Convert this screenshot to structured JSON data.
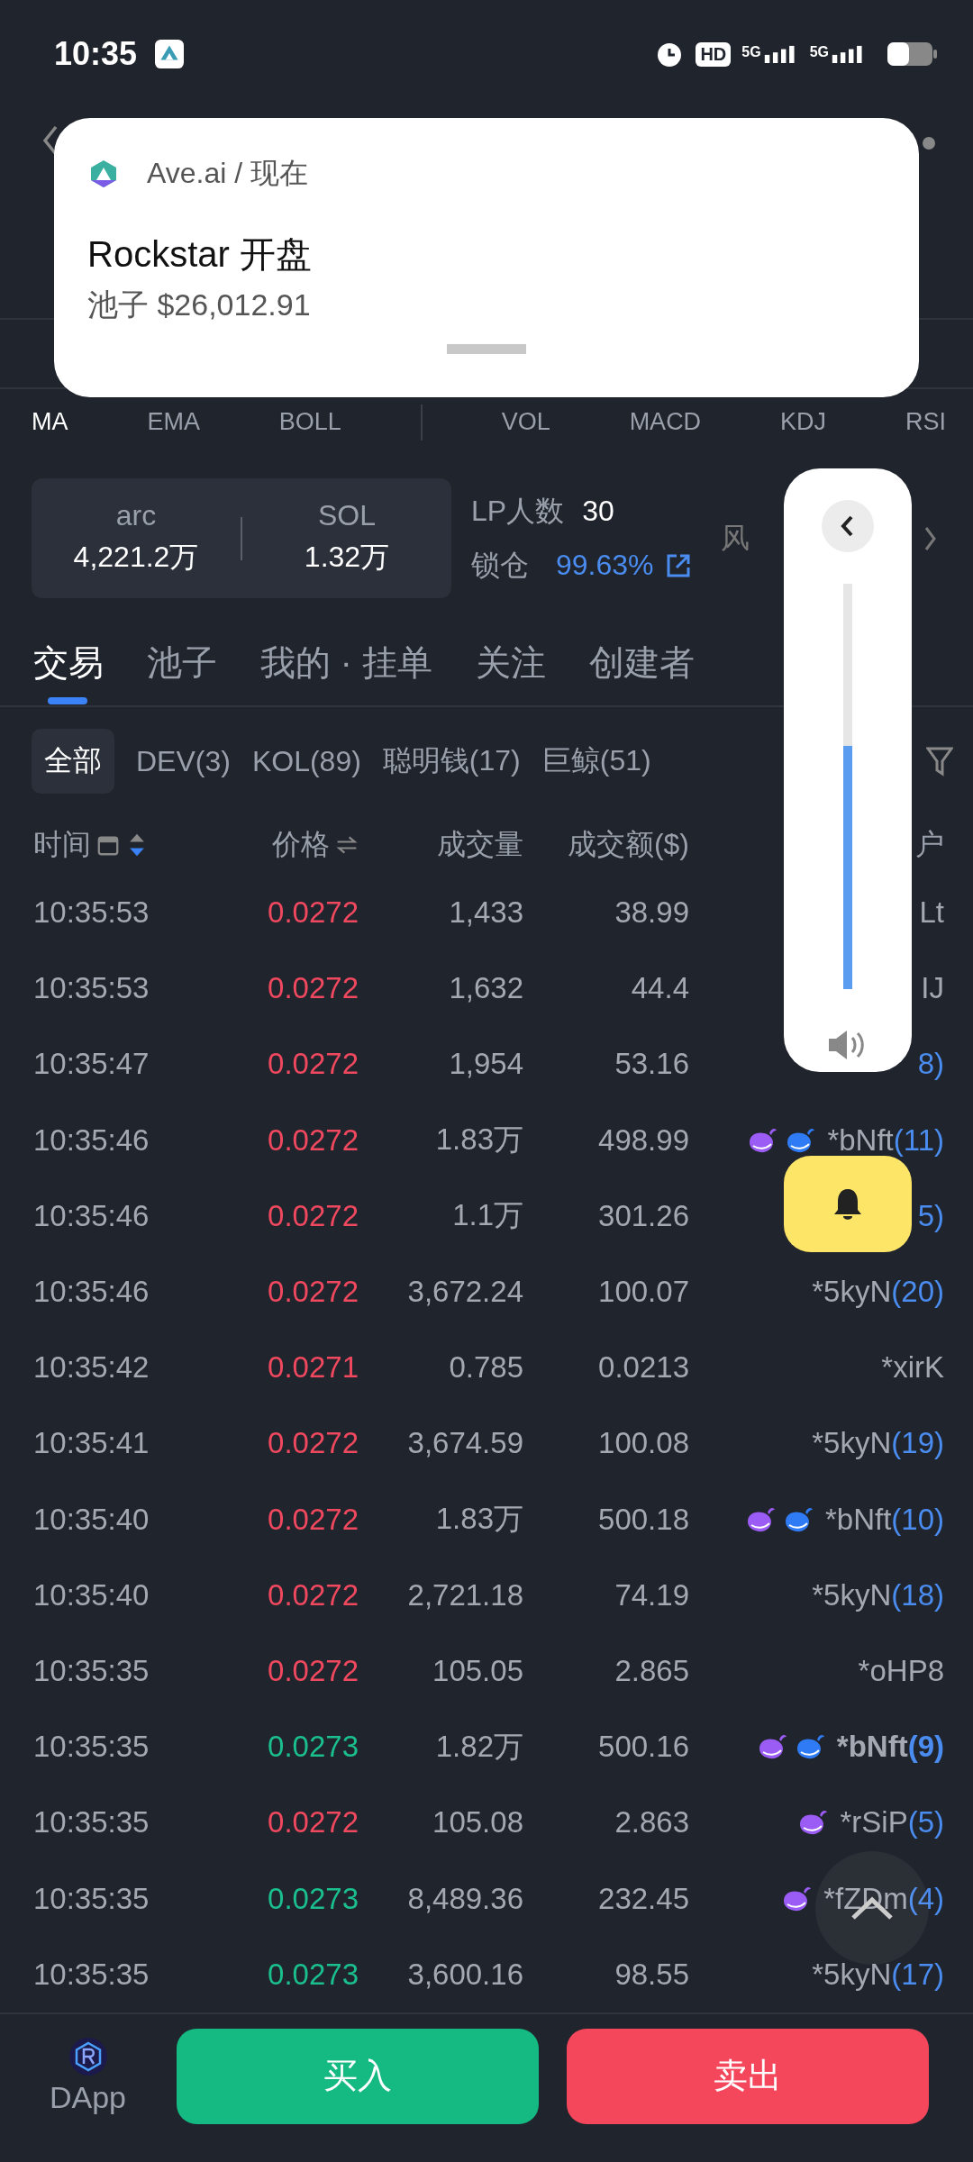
{
  "status_bar": {
    "time": "10:35",
    "hd": "HD",
    "networks": [
      "5G",
      "5G"
    ]
  },
  "notification": {
    "app": "Ave.ai / 现在",
    "title": "Rockstar 开盘",
    "body": "池子 $26,012.91"
  },
  "indicators": {
    "main": [
      {
        "label": "MA",
        "selected": true
      },
      {
        "label": "EMA",
        "selected": false
      },
      {
        "label": "BOLL",
        "selected": false
      }
    ],
    "sub": [
      {
        "label": "VOL",
        "selected": false
      },
      {
        "label": "MACD",
        "selected": false
      },
      {
        "label": "KDJ",
        "selected": false
      },
      {
        "label": "RSI",
        "selected": false
      }
    ]
  },
  "pool": [
    {
      "symbol": "arc",
      "amount": "4,221.2万"
    },
    {
      "symbol": "SOL",
      "amount": "1.32万"
    }
  ],
  "lp": {
    "holders_label": "LP人数",
    "holders": "30",
    "lock_label": "锁仓",
    "lock": "99.63%",
    "risk_label": "风"
  },
  "tabs": [
    {
      "label": "交易",
      "selected": true
    },
    {
      "label": "池子",
      "selected": false
    },
    {
      "label": "我的 · 挂单",
      "selected": false
    },
    {
      "label": "关注",
      "selected": false
    },
    {
      "label": "创建者",
      "selected": false
    }
  ],
  "filters": [
    {
      "label": "全部",
      "selected": true
    },
    {
      "label": "DEV(3)",
      "selected": false
    },
    {
      "label": "KOL(89)",
      "selected": false
    },
    {
      "label": "聪明钱(17)",
      "selected": false
    },
    {
      "label": "巨鲸(51)",
      "selected": false
    }
  ],
  "columns": [
    "时间",
    "价格",
    "成交量",
    "成交额($)",
    "户"
  ],
  "trades": [
    {
      "time": "10:35:53",
      "price": "0.0272",
      "up": false,
      "volume": "1,433",
      "amount": "38.99",
      "wallet": "Lt",
      "highlighted": false
    },
    {
      "time": "10:35:53",
      "price": "0.0272",
      "up": false,
      "volume": "1,632",
      "amount": "44.4",
      "wallet": "IJ",
      "highlighted": false
    },
    {
      "time": "10:35:47",
      "price": "0.0272",
      "up": false,
      "volume": "1,954",
      "amount": "53.16",
      "count": "8)",
      "highlighted": false
    },
    {
      "time": "10:35:46",
      "price": "0.0272",
      "up": false,
      "volume": "1.83万",
      "amount": "498.99",
      "badges": [
        {
          "color": "#9b5cf6"
        },
        {
          "color": "#2f7bf5"
        }
      ],
      "wallet": "*bNft",
      "count": "(11)",
      "highlighted": false
    },
    {
      "time": "10:35:46",
      "price": "0.0272",
      "up": false,
      "volume": "1.1万",
      "amount": "301.26",
      "count": "5)",
      "highlighted": false
    },
    {
      "time": "10:35:46",
      "price": "0.0272",
      "up": false,
      "volume": "3,672.24",
      "amount": "100.07",
      "wallet": "*5kyN",
      "count": "(20)",
      "highlighted": false
    },
    {
      "time": "10:35:42",
      "price": "0.0271",
      "up": false,
      "volume": "0.785",
      "amount": "0.0213",
      "wallet": "*xirK",
      "highlighted": false
    },
    {
      "time": "10:35:41",
      "price": "0.0272",
      "up": false,
      "volume": "3,674.59",
      "amount": "100.08",
      "wallet": "*5kyN",
      "count": "(19)",
      "highlighted": false
    },
    {
      "time": "10:35:40",
      "price": "0.0272",
      "up": false,
      "volume": "1.83万",
      "amount": "500.18",
      "badges": [
        {
          "color": "#9b5cf6"
        },
        {
          "color": "#2f7bf5"
        }
      ],
      "wallet": "*bNft",
      "count": "(10)",
      "highlighted": false
    },
    {
      "time": "10:35:40",
      "price": "0.0272",
      "up": false,
      "volume": "2,721.18",
      "amount": "74.19",
      "wallet": "*5kyN",
      "count": "(18)",
      "highlighted": false
    },
    {
      "time": "10:35:35",
      "price": "0.0272",
      "up": false,
      "volume": "105.05",
      "amount": "2.865",
      "wallet": "*oHP8",
      "highlighted": false
    },
    {
      "time": "10:35:35",
      "price": "0.0273",
      "up": true,
      "volume": "1.82万",
      "amount": "500.16",
      "badges": [
        {
          "color": "#9b5cf6"
        },
        {
          "color": "#2f7bf5"
        }
      ],
      "wallet": "*bNft",
      "count": "(9)",
      "highlighted": true
    },
    {
      "time": "10:35:35",
      "price": "0.0272",
      "up": false,
      "volume": "105.08",
      "amount": "2.863",
      "badges": [
        {
          "color": "#9b5cf6"
        }
      ],
      "wallet": "*rSiP",
      "count": "(5)",
      "highlighted": false
    },
    {
      "time": "10:35:35",
      "price": "0.0273",
      "up": true,
      "volume": "8,489.36",
      "amount": "232.45",
      "badges": [
        {
          "color": "#9b5cf6"
        }
      ],
      "wallet": "*fZDm",
      "count": "(4)",
      "highlighted": false
    },
    {
      "time": "10:35:35",
      "price": "0.0273",
      "up": true,
      "volume": "3,600.16",
      "amount": "98.55",
      "wallet": "*5kyN",
      "count": "(17)",
      "highlighted": false
    }
  ],
  "volume": {
    "level": 0.6
  },
  "bottom": {
    "dapp": "DApp",
    "buy": "买入",
    "sell": "卖出"
  }
}
